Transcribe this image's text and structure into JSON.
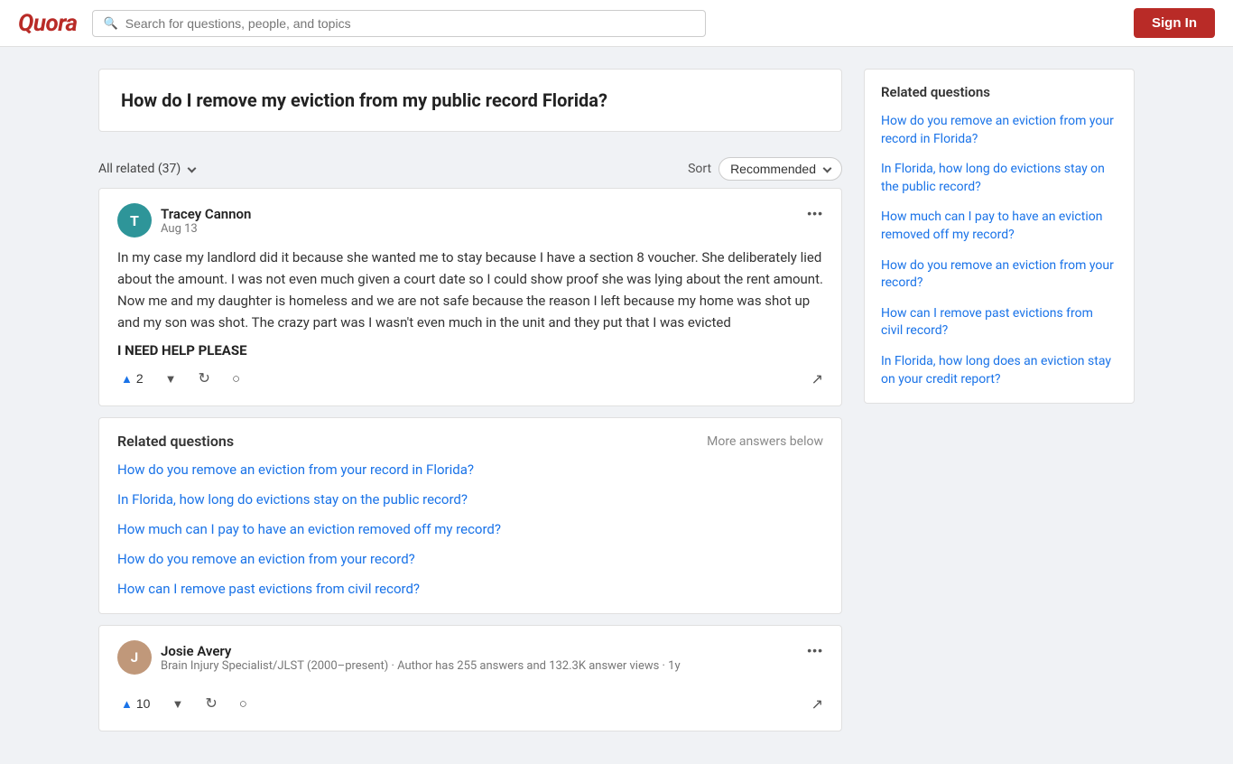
{
  "header": {
    "logo": "Quora",
    "search_placeholder": "Search for questions, people, and topics",
    "sign_in_label": "Sign In"
  },
  "question": {
    "title": "How do I remove my eviction from my public record Florida?"
  },
  "filter": {
    "all_related": "All related (37)",
    "sort_label": "Sort",
    "recommended_label": "Recommended"
  },
  "answers": [
    {
      "id": "answer-1",
      "user_initial": "T",
      "user_name": "Tracey Cannon",
      "user_date": "Aug 13",
      "avatar_bg": "#2e9599",
      "text": "In my case my landlord did it because she wanted me to stay because I have a section 8 voucher. She deliberately lied about the amount. I was not even much given a court date so I could show proof she was lying about the rent amount. Now me and my daughter is homeless and we are not safe because the reason I left because my home was shot up and my son was shot. The crazy part was I wasn't even much in the unit and they put that I was evicted",
      "help_text": "I NEED HELP PLEASE",
      "upvotes": "2"
    },
    {
      "id": "answer-2",
      "user_initial": "J",
      "user_name": "Josie Avery",
      "user_bio": "Brain Injury Specialist/JLST (2000–present) · Author has 255 answers and 132.3K answer views · 1y",
      "avatar_bg": "#888",
      "upvotes": "10"
    }
  ],
  "related_questions_inline": {
    "title": "Related questions",
    "more_label": "More answers below",
    "links": [
      "How do you remove an eviction from your record in Florida?",
      "In Florida, how long do evictions stay on the public record?",
      "How much can I pay to have an eviction removed off my record?",
      "How do you remove an eviction from your record?",
      "How can I remove past evictions from civil record?"
    ]
  },
  "sidebar": {
    "title": "Related questions",
    "links": [
      "How do you remove an eviction from your record in Florida?",
      "In Florida, how long do evictions stay on the public record?",
      "How much can I pay to have an eviction removed off my record?",
      "How do you remove an eviction from your record?",
      "How can I remove past evictions from civil record?",
      "In Florida, how long does an eviction stay on your credit report?"
    ]
  }
}
